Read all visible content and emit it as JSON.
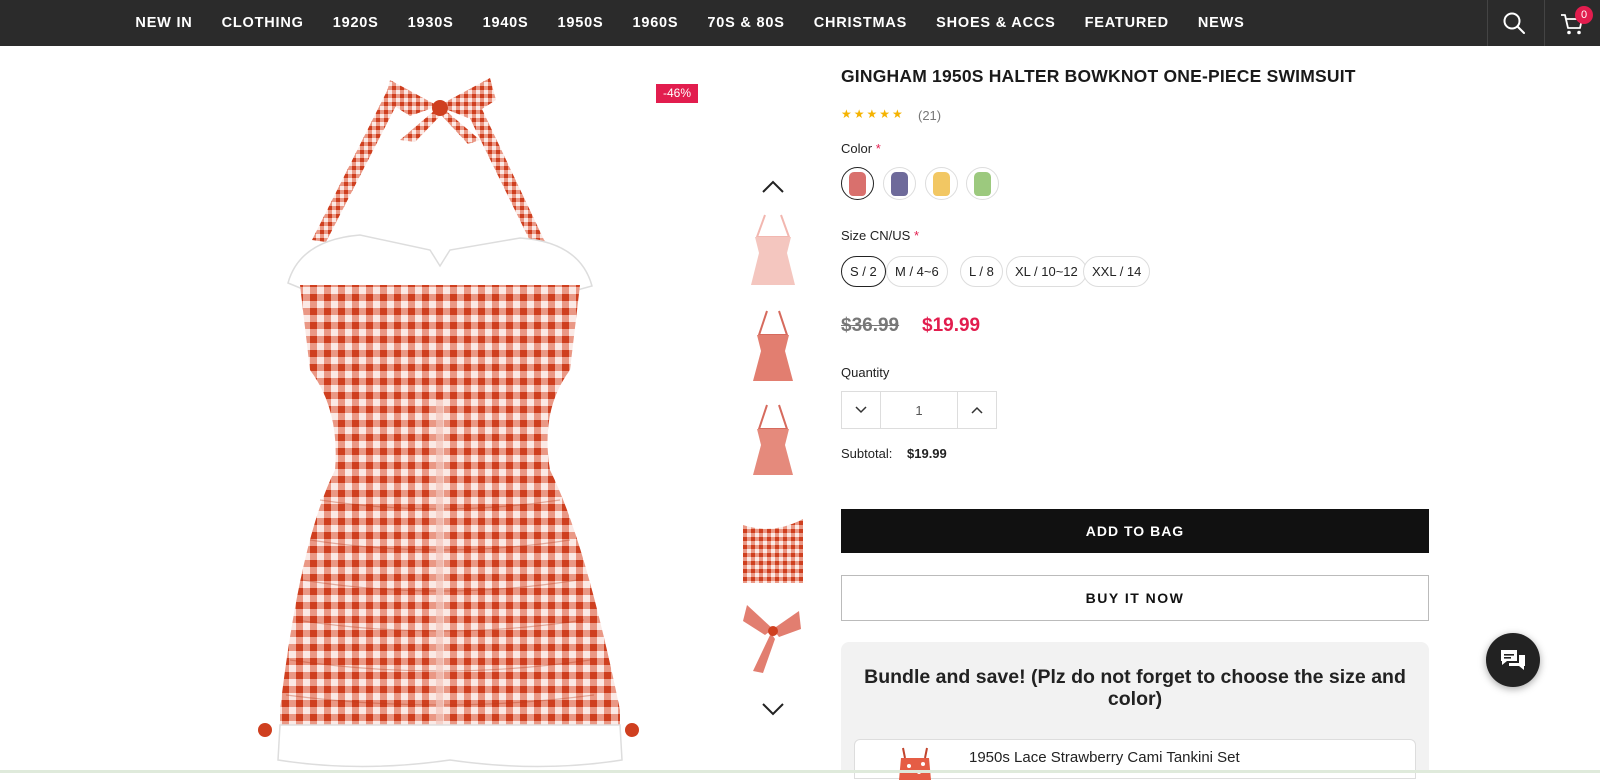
{
  "nav": {
    "links": [
      "NEW IN",
      "CLOTHING",
      "1920S",
      "1930S",
      "1940S",
      "1950S",
      "1960S",
      "70S & 80S",
      "CHRISTMAS",
      "SHOES & ACCS",
      "FEATURED",
      "NEWS"
    ],
    "cart_count": "0"
  },
  "product": {
    "title": "GINGHAM 1950S HALTER BOWKNOT ONE-PIECE SWIMSUIT",
    "stars": "★★★★★",
    "review_count": "(21)",
    "discount_badge": "-46%",
    "color_label": "Color",
    "required_mark": "*",
    "colors": [
      {
        "name": "Red",
        "hex": "#d9706d"
      },
      {
        "name": "Blue",
        "hex": "#6e6a9a"
      },
      {
        "name": "Yellow",
        "hex": "#f2c763"
      },
      {
        "name": "Green",
        "hex": "#9cc97e"
      }
    ],
    "size_label": "Size CN/US",
    "sizes": [
      "S / 2",
      "M / 4~6",
      "L / 8",
      "XL / 10~12",
      "XXL / 14"
    ],
    "old_price": "$36.99",
    "new_price": "$19.99",
    "quantity_label": "Quantity",
    "quantity": "1",
    "subtotal_label": "Subtotal:",
    "subtotal": "$19.99",
    "add_to_bag": "ADD TO BAG",
    "buy_now": "BUY IT NOW"
  },
  "bundle": {
    "title": "Bundle and save! (Plz do not forget to choose the size and color)",
    "items": [
      {
        "name": "1950s Lace Strawberry Cami Tankini Set"
      }
    ]
  },
  "colors": {
    "accent": "#e21d4e",
    "nav_bg": "#2b2b2b",
    "gingham": "#d94b2b"
  }
}
